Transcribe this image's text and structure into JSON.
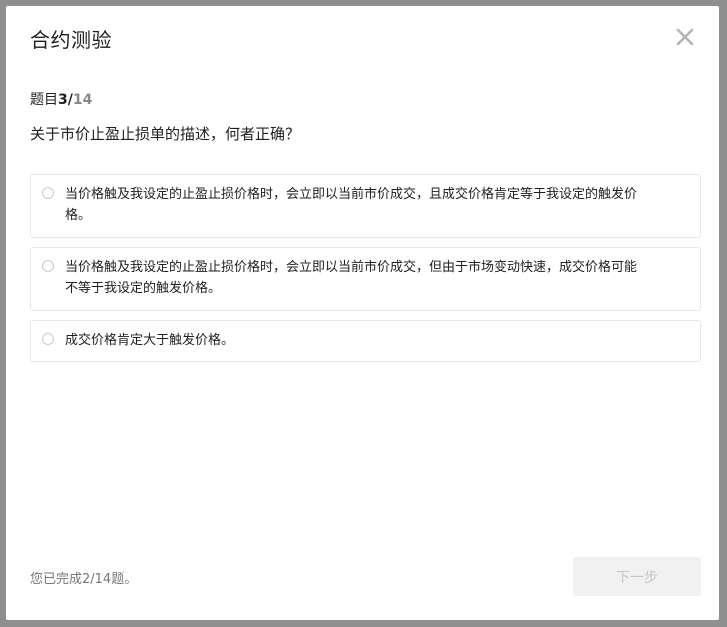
{
  "dialog": {
    "title": "合约测验",
    "close_icon": "close-icon"
  },
  "progress": {
    "label": "题目",
    "current": "3",
    "separator": "/",
    "total": "14"
  },
  "question": "关于市价止盈止损单的描述，何者正确？",
  "options": [
    {
      "text": "当价格触及我设定的止盈止损价格时，会立即以当前市价成交，且成交价格肯定等于我设定的触发价格。",
      "selected": false
    },
    {
      "text": "当价格触及我设定的止盈止损价格时，会立即以当前市价成交，但由于市场变动快速，成交价格可能不等于我设定的触发价格。",
      "selected": false
    },
    {
      "text": "成交价格肯定大于触发价格。",
      "selected": false
    }
  ],
  "footer": {
    "status": "您已完成2/14题。",
    "next_label": "下一步",
    "next_enabled": false
  },
  "colors": {
    "overlay": "#8f8f8f",
    "button_disabled_bg": "#f1f1f1",
    "button_disabled_text": "#c6c6c6"
  }
}
